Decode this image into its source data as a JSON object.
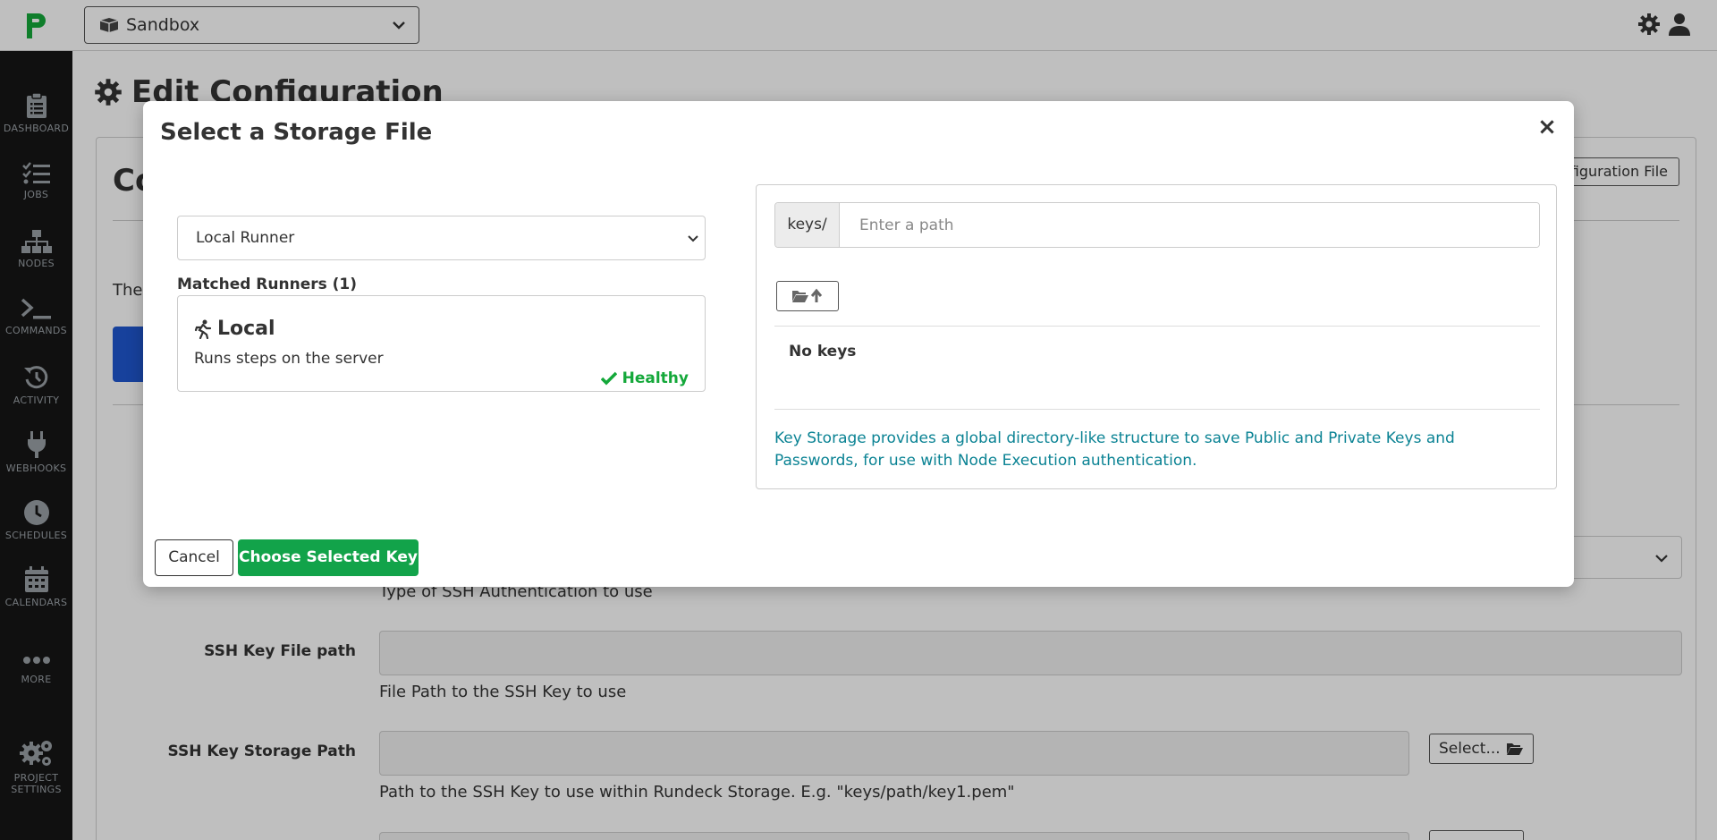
{
  "topbar": {
    "project": "Sandbox",
    "icons": [
      "logo-icon",
      "project-box-icon",
      "chevron-down-icon",
      "gear-icon",
      "user-icon"
    ]
  },
  "sidebar": {
    "items": [
      {
        "label": "DASHBOARD",
        "icon": "clipboard-icon"
      },
      {
        "label": "JOBS",
        "icon": "tasks-icon"
      },
      {
        "label": "NODES",
        "icon": "sitemap-icon"
      },
      {
        "label": "COMMANDS",
        "icon": "terminal-icon"
      },
      {
        "label": "ACTIVITY",
        "icon": "history-icon"
      },
      {
        "label": "WEBHOOKS",
        "icon": "plug-icon"
      },
      {
        "label": "SCHEDULES",
        "icon": "clock-icon"
      },
      {
        "label": "CALENDARS",
        "icon": "calendar-icon"
      },
      {
        "label": "MORE",
        "icon": "ellipsis-icon"
      },
      {
        "label": "PROJECT",
        "label2": "SETTINGS",
        "icon": "gears-icon"
      }
    ]
  },
  "page": {
    "title": "Edit Configuration",
    "card_heading": "Co",
    "card_button": "figuration File",
    "card_text": "The",
    "ssh_auth_help": "Type of SSH Authentication to use",
    "ssh_key_file": {
      "label": "SSH Key File path",
      "value": "",
      "help": "File Path to the SSH Key to use"
    },
    "ssh_key_storage": {
      "label": "SSH Key Storage Path",
      "value": "",
      "help": "Path to the SSH Key to use within Rundeck Storage. E.g. \"keys/path/key1.pem\"",
      "select_button": "Select..."
    }
  },
  "modal": {
    "title": "Select a Storage File",
    "close": "×",
    "runner_select": "Local Runner",
    "matched_label": "Matched Runners (1)",
    "runner": {
      "name": "Local",
      "description": "Runs steps on the server",
      "status": "Healthy",
      "status_color": "#14a83a"
    },
    "storage": {
      "prefix": "keys/",
      "path_value": "",
      "path_placeholder": "Enter a path",
      "empty": "No keys",
      "info": "Key Storage provides a global directory-like structure to save Public and Private Keys and Passwords, for use with Node Execution authentication.",
      "info_color": "#0b8394"
    },
    "cancel": "Cancel",
    "choose": "Choose Selected Key",
    "choose_color": "#12a34a"
  }
}
